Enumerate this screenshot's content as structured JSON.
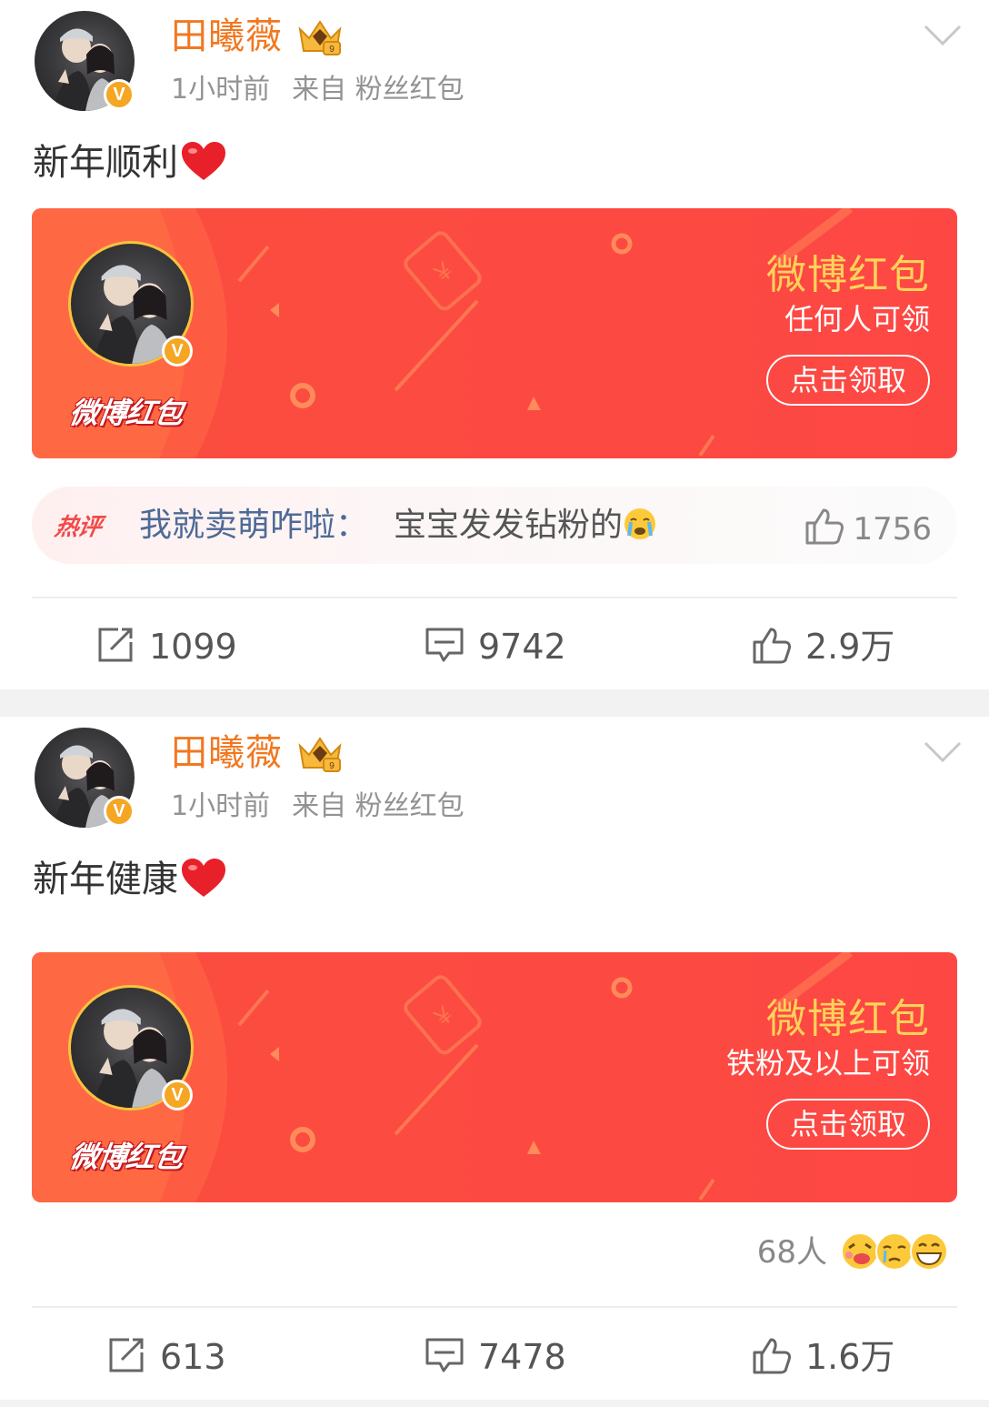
{
  "posts": [
    {
      "username": "田曦薇",
      "time": "1小时前",
      "source": "来自 粉丝红包",
      "text": "新年顺利",
      "redpacket": {
        "brand": "微博红包",
        "title": "微博红包",
        "subtitle": "任何人可领",
        "button": "点击领取"
      },
      "hot_comment": {
        "tag": "热评",
        "user": "我就卖萌咋啦：",
        "text": "宝宝发发钻粉的",
        "likes": "1756"
      },
      "actions": {
        "repost": "1099",
        "comment": "9742",
        "like": "2.9万"
      }
    },
    {
      "username": "田曦薇",
      "time": "1小时前",
      "source": "来自 粉丝红包",
      "text": "新年健康",
      "redpacket": {
        "brand": "微博红包",
        "title": "微博红包",
        "subtitle": "铁粉及以上可领",
        "button": "点击领取"
      },
      "reactions_count": "68人",
      "actions": {
        "repost": "613",
        "comment": "7478",
        "like": "1.6万"
      }
    }
  ],
  "colors": {
    "username": "#f17821",
    "redpacket_bg": "#fc4a42",
    "redpacket_title": "#ffd25a",
    "hot_user": "#4e6a96",
    "verified_badge": "#f5a623"
  },
  "icons": [
    "verified-badge-icon",
    "crown-icon",
    "chevron-down-icon",
    "heart-icon",
    "repost-icon",
    "comment-icon",
    "thumb-up-icon",
    "crying-emoji-icon"
  ]
}
